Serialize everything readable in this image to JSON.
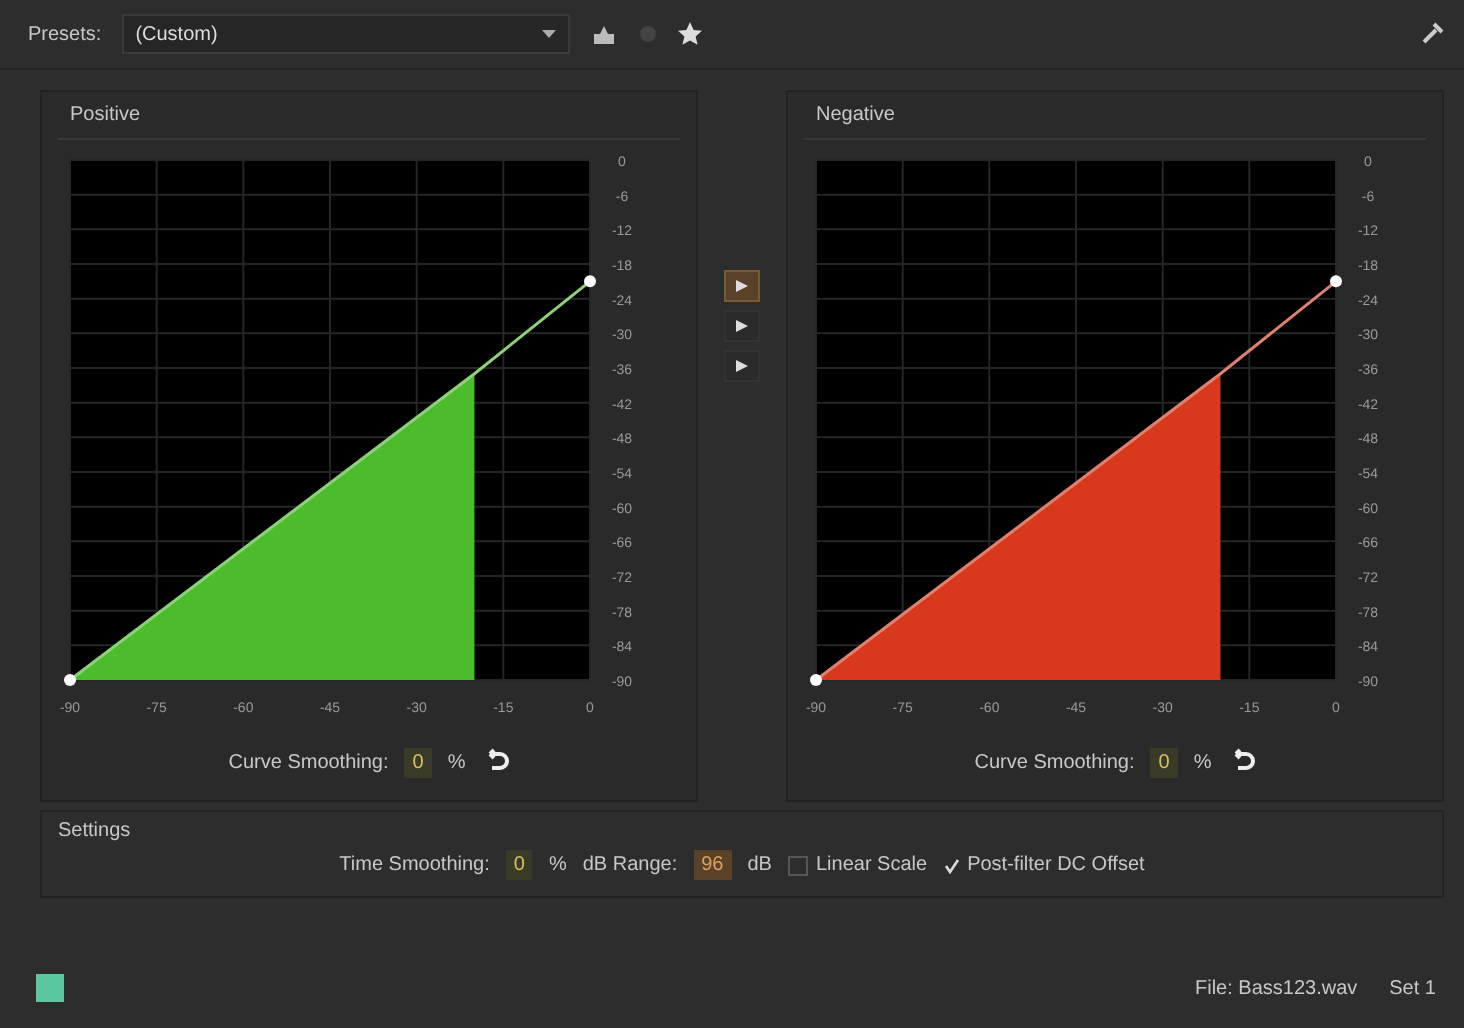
{
  "toolbar": {
    "presets_label": "Presets:",
    "preset_value": "(Custom)"
  },
  "graphs": [
    {
      "title": "Positive",
      "color": "#4cbc2c",
      "chart_data": {
        "type": "line",
        "grid": true,
        "x": [
          -90,
          -20,
          0
        ],
        "series": [
          {
            "color": "#8fd07a",
            "values": [
              -90,
              -37,
              -21
            ]
          }
        ],
        "xlim": [
          -90,
          0
        ],
        "ylim": [
          -90,
          0
        ],
        "xticks": [
          -90,
          -75,
          -60,
          -45,
          -30,
          -15,
          0
        ],
        "yticks": [
          0,
          -6,
          -12,
          -18,
          -24,
          -30,
          -36,
          -42,
          -48,
          -54,
          -60,
          -66,
          -72,
          -78,
          -84,
          -90
        ]
      },
      "smoothing_label": "Curve Smoothing:",
      "smoothing_value": "0",
      "smoothing_unit": "%"
    },
    {
      "title": "Negative",
      "color": "#d8381c",
      "chart_data": {
        "type": "line",
        "grid": true,
        "x": [
          -90,
          -20,
          0
        ],
        "series": [
          {
            "color": "#e08070",
            "values": [
              -90,
              -37,
              -21
            ]
          }
        ],
        "xlim": [
          -90,
          0
        ],
        "ylim": [
          -90,
          0
        ],
        "xticks": [
          -90,
          -75,
          -60,
          -45,
          -30,
          -15,
          0
        ],
        "yticks": [
          0,
          -6,
          -12,
          -18,
          -24,
          -30,
          -36,
          -42,
          -48,
          -54,
          -60,
          -66,
          -72,
          -78,
          -84,
          -90
        ]
      },
      "smoothing_label": "Curve Smoothing:",
      "smoothing_value": "0",
      "smoothing_unit": "%"
    }
  ],
  "link_buttons": [
    {
      "selected": true
    },
    {
      "selected": false
    },
    {
      "selected": false
    }
  ],
  "settings": {
    "title": "Settings",
    "time_label": "Time Smoothing:",
    "time_value": "0",
    "time_unit": "%",
    "range_label": "dB Range:",
    "range_value": "96",
    "range_unit": "dB",
    "linear_label": "Linear Scale",
    "linear_checked": false,
    "dc_label": "Post-filter DC Offset",
    "dc_checked": true
  },
  "status_bar": {
    "file": "File: Bass123.wav",
    "set": "Set 1"
  }
}
